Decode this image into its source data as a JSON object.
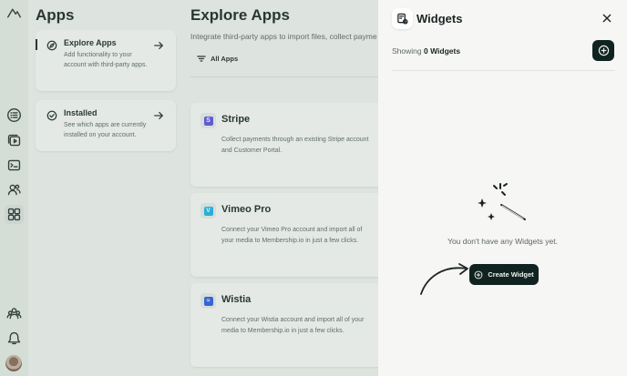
{
  "sidebar_title": "Apps",
  "app_sections": [
    {
      "title": "Explore Apps",
      "description": "Add functionality to your account with third-party apps."
    },
    {
      "title": "Installed",
      "description": "See which apps are currently installed on your account."
    }
  ],
  "explore": {
    "title": "Explore Apps",
    "subtitle": "Integrate third-party apps to import files, collect payme",
    "filter_label": "All Apps",
    "apps": [
      {
        "name": "Stripe",
        "logo_letter": "S",
        "logo_color": "#5b53e0",
        "description": "Collect payments through an existing Stripe account and Customer Portal."
      },
      {
        "name": "Vimeo Pro",
        "logo_letter": "V",
        "logo_color": "#1ab7ea",
        "description": "Connect your Vimeo Pro account and import all of your media to Membership.io in just a few clicks."
      },
      {
        "name": "Wistia",
        "logo_letter": "≈",
        "logo_color": "#2c5ce6",
        "description": "Connect your Wistia account and import all of your media to Membership.io in just a few clicks."
      }
    ]
  },
  "widgets": {
    "title": "Widgets",
    "showing_prefix": "Showing",
    "count": "0",
    "count_suffix": "Widgets",
    "empty_text": "You don't have any Widgets yet.",
    "create_label": "Create Widget"
  },
  "rail_icons": [
    "logo-icon",
    "list-icon",
    "video-library-icon",
    "course-icon",
    "contacts-icon",
    "apps-grid-icon",
    "community-icon",
    "notifications-icon",
    "avatar"
  ],
  "colors": {
    "primary_dark": "#102320",
    "panel_bg": "#f6f6f4"
  }
}
